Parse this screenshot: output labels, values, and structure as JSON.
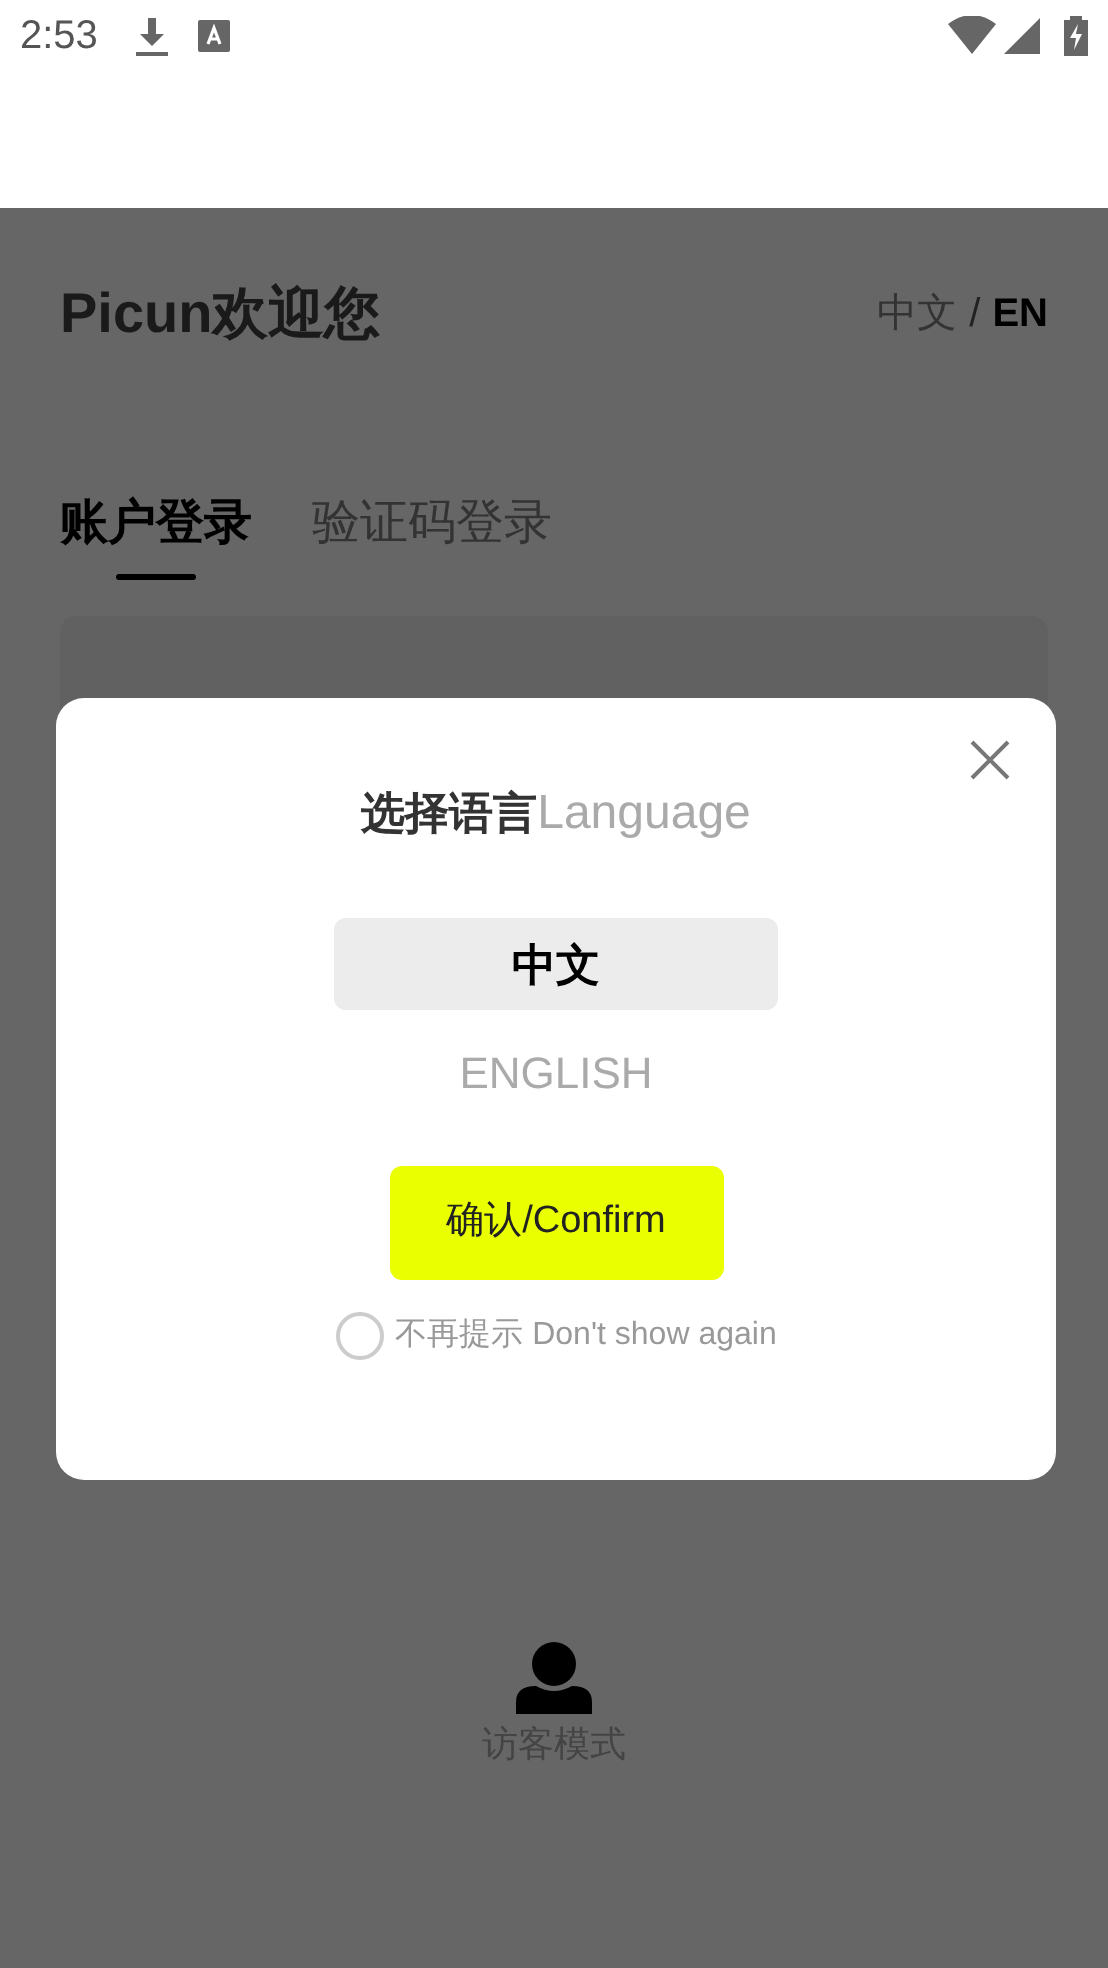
{
  "status_bar": {
    "time": "2:53"
  },
  "header": {
    "title": "Picun欢迎您",
    "languages": [
      {
        "label": "中文",
        "selected": false
      },
      {
        "label": "EN",
        "selected": true
      }
    ],
    "separator": "/"
  },
  "tabs": [
    {
      "label": "账户登录",
      "selected": true
    },
    {
      "label": "验证码登录",
      "selected": false
    }
  ],
  "guest_mode": {
    "label": "访客模式"
  },
  "dialog": {
    "title": "选择语言",
    "title_en": "Language",
    "options": [
      {
        "label": "中文",
        "selected": true
      },
      {
        "label": "ENGLISH",
        "selected": false
      }
    ],
    "confirm": "确认/Confirm",
    "dont_show": {
      "label": "不再提示 Don't show again",
      "checked": false
    }
  }
}
